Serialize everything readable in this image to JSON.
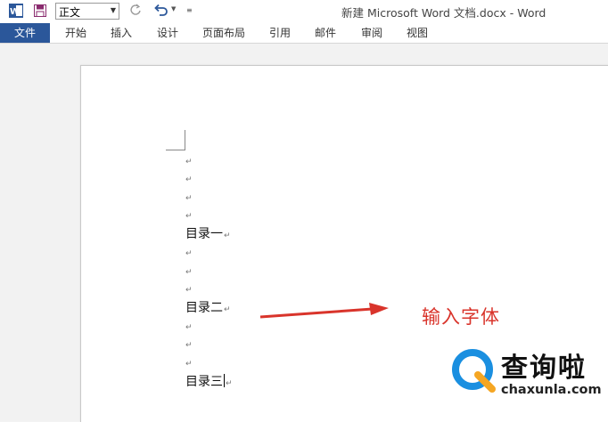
{
  "window": {
    "title": "新建 Microsoft Word 文档.docx - Word"
  },
  "quick_access": {
    "style_value": "正文",
    "icons": [
      "word-icon",
      "save-icon",
      "redo-icon",
      "undo-icon"
    ]
  },
  "ribbon": {
    "file_tab": "文件",
    "tabs": [
      "开始",
      "插入",
      "设计",
      "页面布局",
      "引用",
      "邮件",
      "审阅",
      "视图"
    ]
  },
  "document": {
    "paragraph_mark": "↵",
    "lines": [
      "目录一",
      "目录二",
      "目录三"
    ]
  },
  "annotation": {
    "text": "输入字体",
    "color": "#d9342b"
  },
  "watermark": {
    "name": "查询啦",
    "url": "chaxunla.com"
  },
  "colors": {
    "accent": "#2b579a"
  }
}
